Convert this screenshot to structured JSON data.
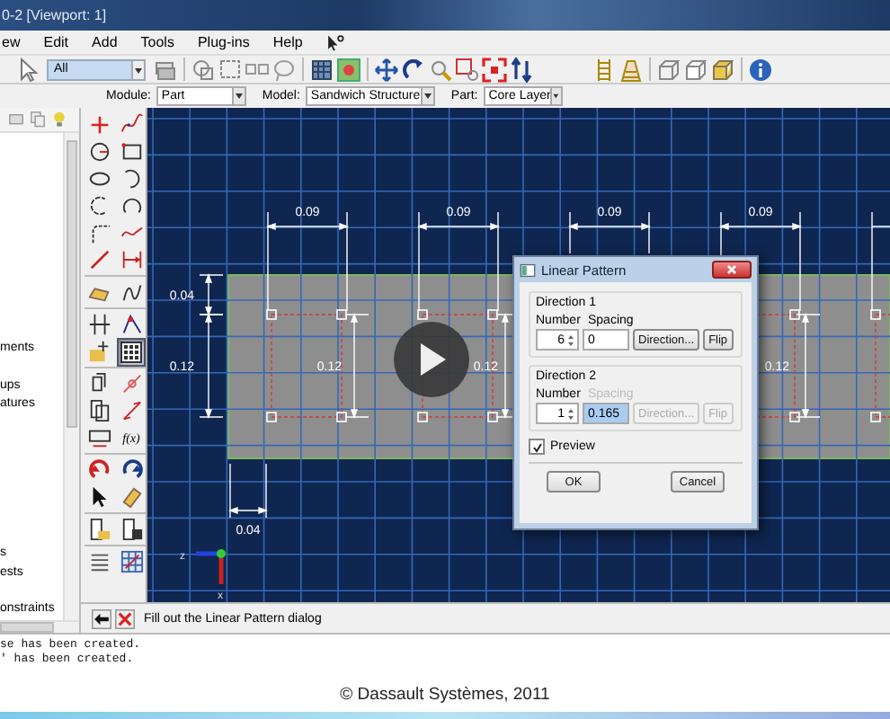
{
  "window": {
    "title": "0-2 [Viewport: 1]"
  },
  "menu": [
    {
      "label": "ew"
    },
    {
      "label": "Edit"
    },
    {
      "label": "Add"
    },
    {
      "label": "Tools"
    },
    {
      "label": "Plug-ins"
    },
    {
      "label": "Help"
    }
  ],
  "toolbar": {
    "selection_filter": "All"
  },
  "context_bar": {
    "module_label": "Module:",
    "module": "Part",
    "model_label": "Model:",
    "model": "Sandwich Structure",
    "part_label": "Part:",
    "part": "Core Layer"
  },
  "model_tree": {
    "items": [
      "ments",
      "ups",
      "atures",
      "s",
      "ests",
      "onstraints"
    ]
  },
  "toolbox": {
    "function_button": "f(x)",
    "linear_pattern_tool": {
      "selected": true
    }
  },
  "viewport": {
    "horizontal_dimensions": [
      "0.09",
      "0.09",
      "0.09",
      "0.09"
    ],
    "vertical_dimensions": [
      "0.04",
      "0.12",
      "0.12",
      "0.12",
      "0.12"
    ],
    "bottom_dimension": "0.04",
    "triad_labels": [
      "z",
      "x"
    ]
  },
  "dialog": {
    "title": "Linear Pattern",
    "directions": [
      {
        "heading": "Direction 1",
        "number_label": "Number",
        "spacing_label": "Spacing",
        "number": "6",
        "spacing": "0",
        "direction_button": "Direction...",
        "flip_button": "Flip",
        "disabled": false,
        "spacing_selected": false
      },
      {
        "heading": "Direction 2",
        "number_label": "Number",
        "spacing_label": "Spacing",
        "number": "1",
        "spacing": "0.165",
        "direction_button": "Direction...",
        "flip_button": "Flip",
        "disabled": true,
        "spacing_selected": true
      }
    ],
    "preview": {
      "label": "Preview",
      "checked": true
    },
    "buttons": [
      "OK",
      "Cancel"
    ]
  },
  "prompt": "Fill out the Linear Pattern dialog",
  "messages": [
    "se has been created.",
    "' has been created."
  ],
  "credit": "© Dassault Systèmes, 2011"
}
